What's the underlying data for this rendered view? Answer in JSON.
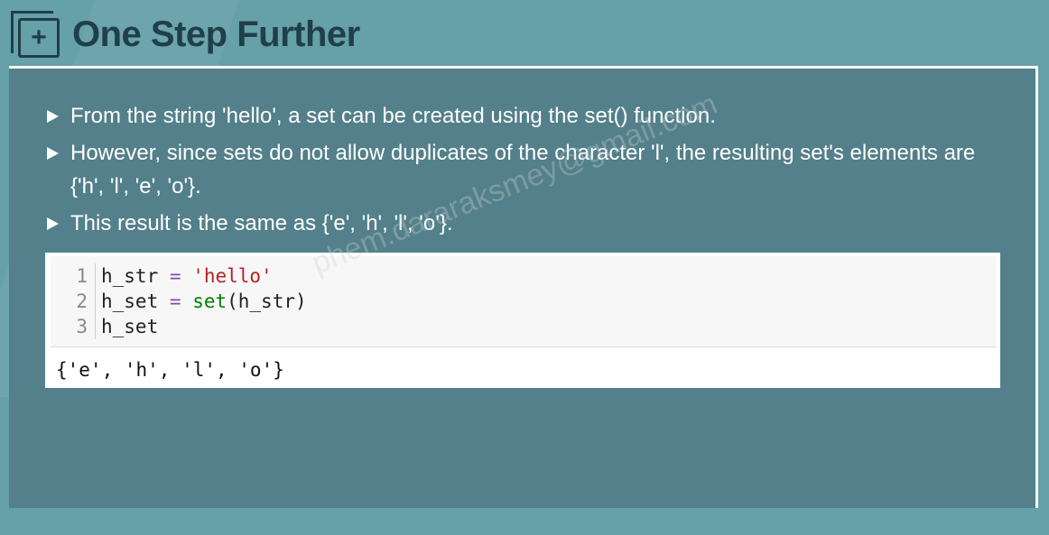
{
  "header": {
    "title": "One Step Further",
    "icon": "plus-square-icon",
    "icon_glyph": "+"
  },
  "bullets": [
    "From the string 'hello', a set can be created using the set() function.",
    "However, since sets do not allow duplicates of the character 'l', the resulting set's elements are {'h', 'l', 'e', 'o'}.",
    "This result is the same as {'e', 'h', 'l', 'o'}."
  ],
  "code": {
    "lines": [
      {
        "num": "1",
        "var": "h_str",
        "op": "=",
        "str": "'hello'"
      },
      {
        "num": "2",
        "var": "h_set",
        "op": "=",
        "fn": "set",
        "args": "(h_str)"
      },
      {
        "num": "3",
        "var": "h_set"
      }
    ],
    "output": "{'e', 'h', 'l', 'o'}"
  },
  "watermark": "phem.dararaksmey@gmail.com",
  "colors": {
    "background": "#66a0a9",
    "panel": "#53808a",
    "title": "#1f3f4a",
    "string": "#ba2121",
    "builtin": "#008000",
    "operator": "#7a4ea8"
  }
}
